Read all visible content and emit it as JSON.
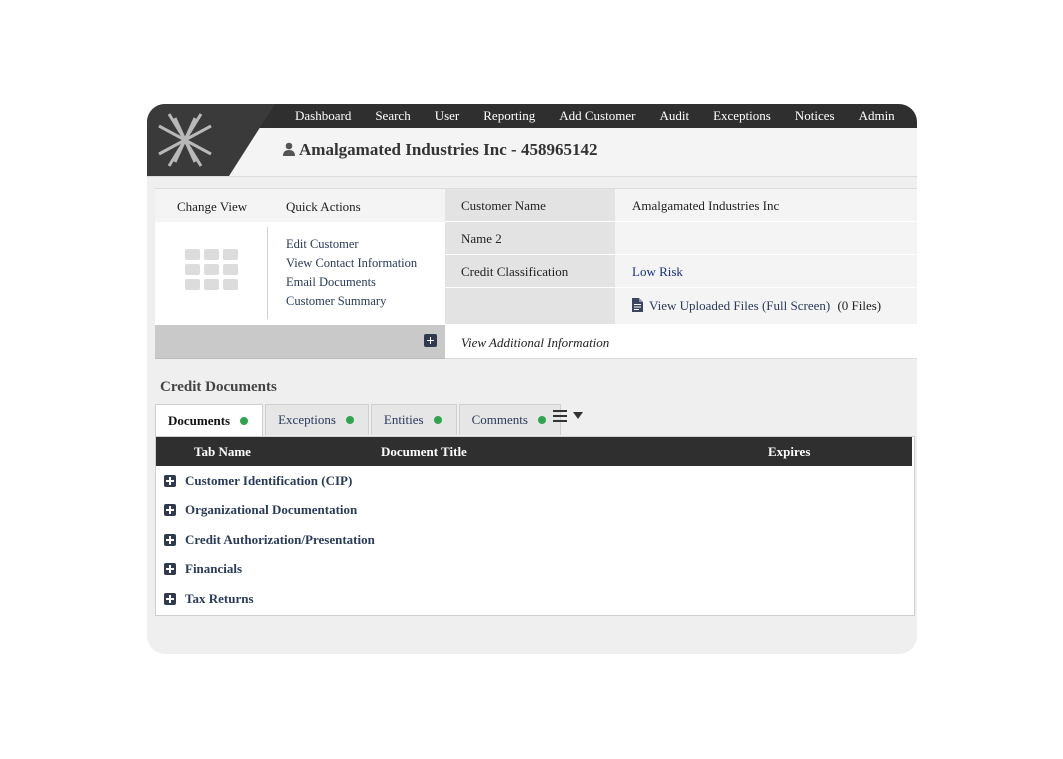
{
  "nav": {
    "items": [
      "Dashboard",
      "Search",
      "User",
      "Reporting",
      "Add Customer",
      "Audit",
      "Exceptions",
      "Notices",
      "Admin"
    ]
  },
  "header": {
    "title": "Amalgamated Industries Inc - 458965142",
    "logo_icon": "star-knot-logo"
  },
  "panel": {
    "change_view_label": "Change View",
    "quick_actions_label": "Quick Actions",
    "quick_actions": [
      "Edit Customer",
      "View Contact Information",
      "Email Documents",
      "Customer Summary"
    ],
    "rows": [
      {
        "label": "Customer Name",
        "value": "Amalgamated Industries Inc"
      },
      {
        "label": "Name 2",
        "value": ""
      },
      {
        "label": "Credit Classification",
        "value": "Low Risk"
      },
      {
        "label": "",
        "value": ""
      }
    ],
    "files_link": "View Uploaded Files",
    "files_full_screen": "(Full Screen)",
    "files_count": "(0 Files)",
    "view_additional": "View Additional Information",
    "risk_color": "#1a2f7a"
  },
  "credit_documents": {
    "title": "Credit Documents",
    "tabs": [
      {
        "label": "Documents",
        "status": "green"
      },
      {
        "label": "Exceptions",
        "status": "green"
      },
      {
        "label": "Entities",
        "status": "green"
      },
      {
        "label": "Comments",
        "status": "green"
      }
    ],
    "status_color": "#2ea44f",
    "columns": [
      "Tab Name",
      "Document Title",
      "Expires"
    ],
    "rows": [
      "Customer Identification (CIP)",
      "Organizational Documentation",
      "Credit Authorization/Presentation",
      "Financials",
      "Tax Returns"
    ]
  }
}
